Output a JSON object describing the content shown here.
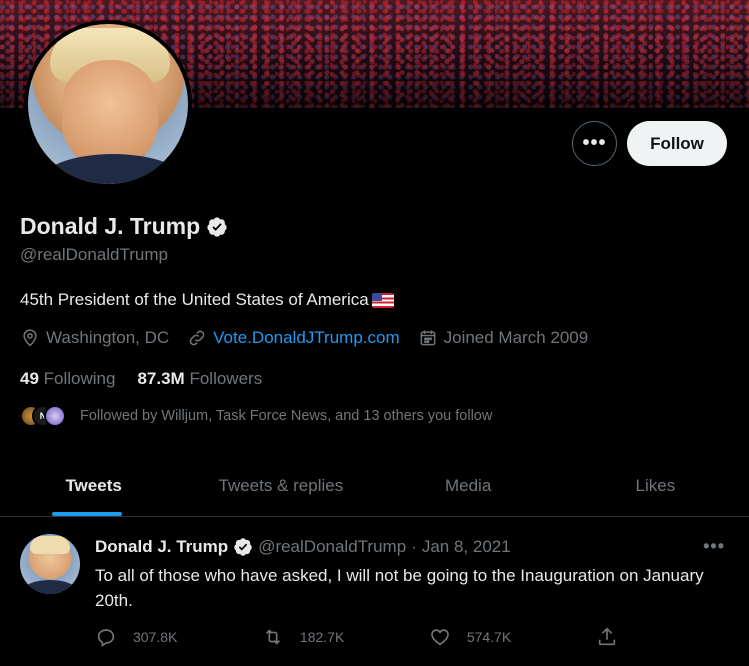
{
  "profile": {
    "name": "Donald J. Trump",
    "handle": "@realDonaldTrump",
    "bio": "45th President of the United States of America",
    "location": "Washington, DC",
    "website": "Vote.DonaldJTrump.com",
    "joined": "Joined March 2009",
    "following_count": "49",
    "following_label": "Following",
    "followers_count": "87.3M",
    "followers_label": "Followers",
    "followed_by": "Followed by Willjum, Task Force News, and 13 others you follow",
    "more_label": "•••",
    "follow_label": "Follow"
  },
  "tabs": [
    {
      "label": "Tweets"
    },
    {
      "label": "Tweets & replies"
    },
    {
      "label": "Media"
    },
    {
      "label": "Likes"
    }
  ],
  "tweet": {
    "name": "Donald J. Trump",
    "handle": "@realDonaldTrump",
    "separator": "·",
    "date": "Jan 8, 2021",
    "more": "•••",
    "text": "To all of those who have asked, I will not be going to the Inauguration on January 20th.",
    "replies": "307.8K",
    "retweets": "182.7K",
    "likes": "574.7K"
  },
  "mini_avatar_n": "N",
  "colors": {
    "background": "#000000",
    "accent": "#1d9bf0",
    "muted": "#71767b",
    "text": "#e7e9ea"
  }
}
